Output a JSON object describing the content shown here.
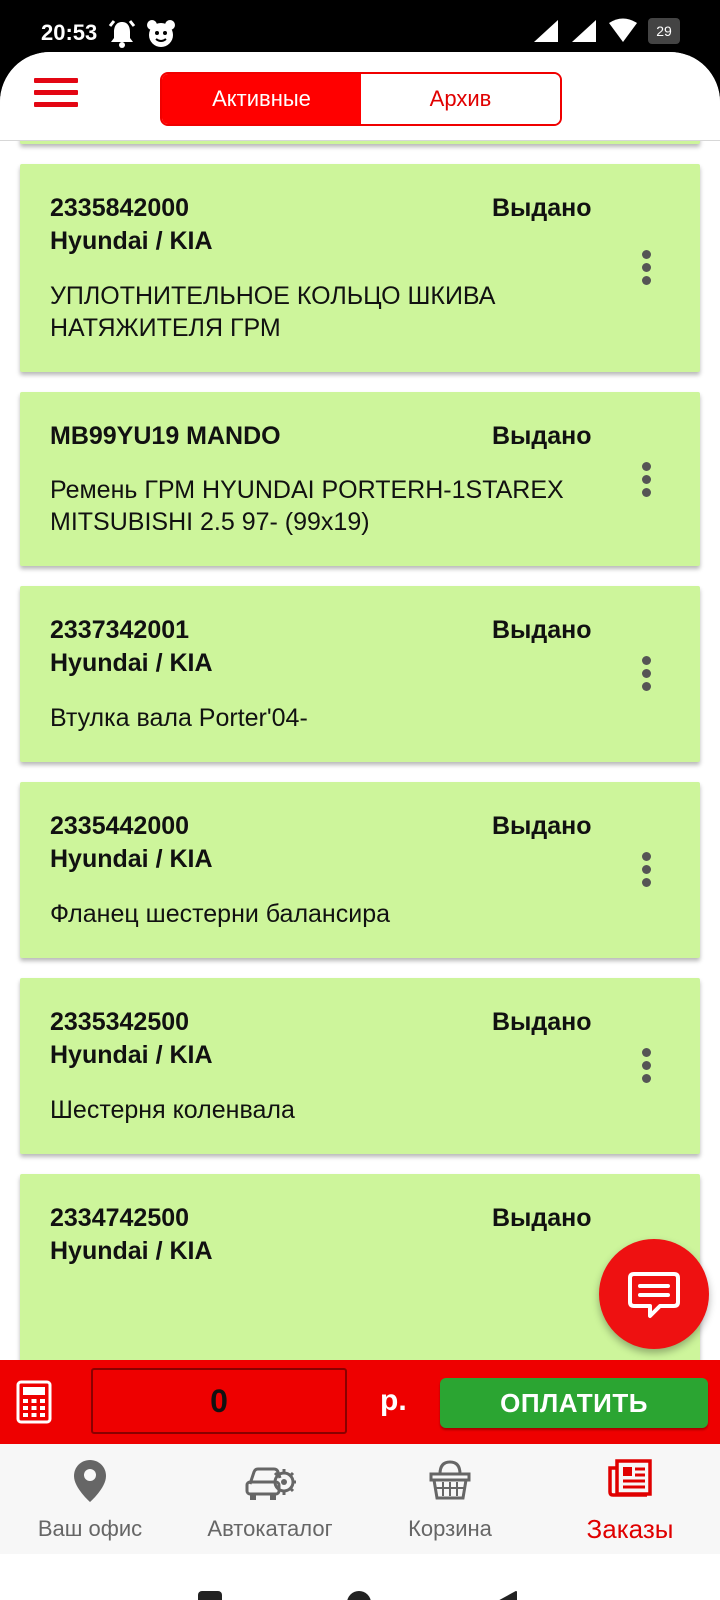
{
  "status_bar": {
    "time": "20:53",
    "battery": "29"
  },
  "tabs": {
    "active": "Активные",
    "archive": "Архив"
  },
  "orders": [
    {
      "code": "2335842000",
      "brand": "Hyundai / KIA",
      "status": "Выдано",
      "desc": "УПЛОТНИТЕЛЬНОЕ КОЛЬЦО ШКИВА НАТЯЖИТЕЛЯ ГРМ"
    },
    {
      "code": "MB99YU19 MANDO",
      "brand": "",
      "status": "Выдано",
      "desc": "Ремень ГРМ HYUNDAI PORTERH-1STAREX MITSUBISHI 2.5 97- (99x19)"
    },
    {
      "code": "2337342001",
      "brand": "Hyundai / KIA",
      "status": "Выдано",
      "desc": "Втулка вала Porter'04-"
    },
    {
      "code": "2335442000",
      "brand": "Hyundai / KIA",
      "status": "Выдано",
      "desc": "Фланец шестерни балансира"
    },
    {
      "code": "2335342500",
      "brand": "Hyundai / KIA",
      "status": "Выдано",
      "desc": "Шестерня коленвала"
    },
    {
      "code": "2334742500",
      "brand": "Hyundai / KIA",
      "status": "Выдано",
      "desc": ""
    }
  ],
  "payment": {
    "amount": "0",
    "currency": "р.",
    "pay_label": "ОПЛАТИТЬ"
  },
  "nav": {
    "office": "Ваш офис",
    "catalog": "Автокаталог",
    "cart": "Корзина",
    "orders": "Заказы"
  },
  "colors": {
    "brand_red": "#ff0000",
    "card_green": "#cdf59b",
    "pay_green": "#2ba532"
  }
}
